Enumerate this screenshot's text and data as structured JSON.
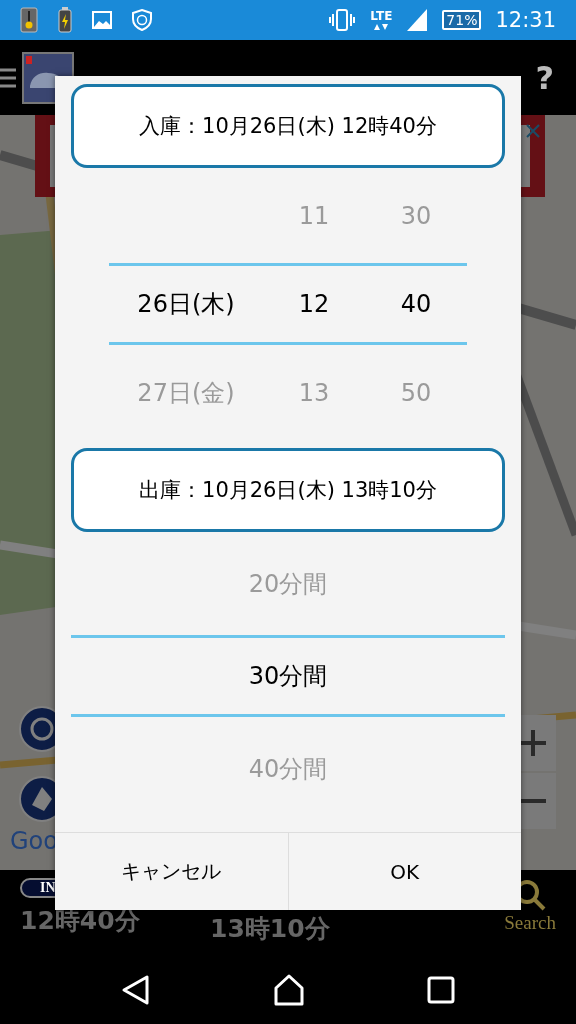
{
  "status_bar": {
    "network": "LTE",
    "battery": "71%",
    "time": "12:31"
  },
  "app_bar": {
    "help": "?"
  },
  "map": {
    "attribution": "Goo"
  },
  "bottom_bar": {
    "in_badge": "IN",
    "start_time": "12時40分",
    "end_time": "13時10分",
    "search": "Search"
  },
  "dialog": {
    "start_header": "入庫：10月26日(木) 12時40分",
    "start_rows": [
      {
        "hour": "11",
        "minute": "30",
        "selected": false
      },
      {
        "date": "26日(木)",
        "hour": "12",
        "minute": "40",
        "selected": true
      },
      {
        "date": "27日(金)",
        "hour": "13",
        "minute": "50",
        "selected": false
      }
    ],
    "end_header": "出庫：10月26日(木) 13時10分",
    "duration_rows": [
      {
        "text": "20分間",
        "selected": false
      },
      {
        "text": "30分間",
        "selected": true
      },
      {
        "text": "40分間",
        "selected": false
      }
    ],
    "buttons": [
      "キャンセル",
      "OK"
    ]
  }
}
